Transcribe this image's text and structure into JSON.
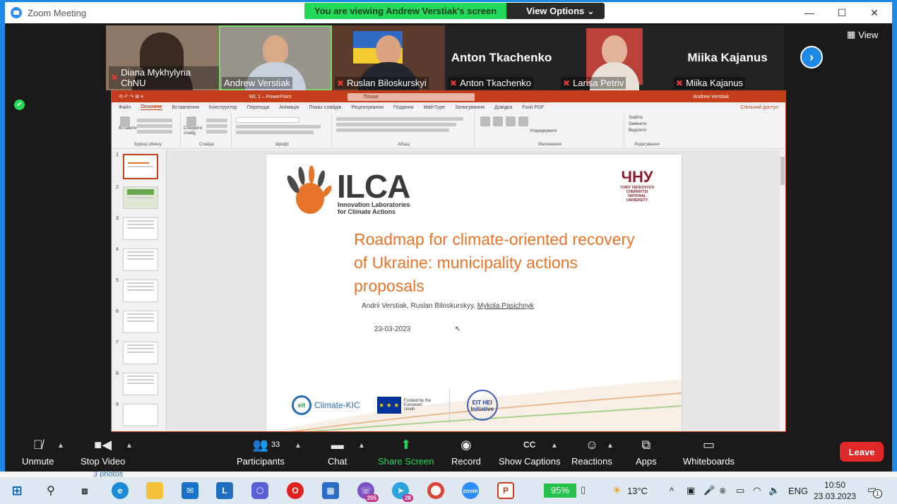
{
  "window": {
    "title": "Zoom Meeting",
    "controls": {
      "minimize": "—",
      "maximize": "☐",
      "close": "✕"
    }
  },
  "share_banner": {
    "viewing": "You are viewing Andrew Verstiak's screen",
    "view_options": "View Options ⌄"
  },
  "gallery": {
    "participants": [
      {
        "name": "Diana Mykhylyna ChNU",
        "video": true,
        "muted": true
      },
      {
        "name": "Andrew Verstiak",
        "video": true,
        "muted": false,
        "active_speaker": true
      },
      {
        "name": "Ruslan Biloskurskyi",
        "video": true,
        "muted": true
      },
      {
        "name": "Anton Tkachenko",
        "video": false,
        "muted": true,
        "big_name": "Anton Tkachenko"
      },
      {
        "name": "Larisa Petriv",
        "video": true,
        "muted": true
      },
      {
        "name": "Miika Kajanus",
        "video": false,
        "muted": true,
        "big_name": "Miika Kajanus"
      }
    ],
    "next_arrow": "›",
    "view_label": "View"
  },
  "ppt": {
    "doc_title": "WL 1 – PowerPoint",
    "search_placeholder": "Пошук",
    "user": "Andrew Verstiak",
    "quick_access": "⟲ ↶ ↷ ⊞ ▾",
    "menu": [
      "Файл",
      "Основне",
      "Вставлення",
      "Конструктор",
      "Переходи",
      "Анімація",
      "Показ слайдів",
      "Рецензування",
      "Подання",
      "MathType",
      "Записування",
      "Довідка",
      "Foxit PDF"
    ],
    "active_menu": "Основне",
    "share_label": "Спільний доступ",
    "ribbon_groups": [
      "Буфер обміну",
      "Слайди",
      "Шрифт",
      "Абзац",
      "Малювання",
      "Редагування"
    ],
    "ribbon_buttons": {
      "paste": "Вставити",
      "new_slide": "Створити слайд",
      "arrange": "Упорядкувати",
      "find": "Знайти",
      "replace": "Замінити",
      "select": "Виділити"
    },
    "slide_numbers": [
      "1",
      "2",
      "3",
      "4",
      "5",
      "6",
      "7",
      "8",
      "9"
    ],
    "slide": {
      "logo_name": "ILCA",
      "logo_sub_1": "Innovation Laboratories",
      "logo_sub_2": "for Climate Actions",
      "univ_mark": "ЧНУ",
      "univ_line_1": "YURIY FEDKOVYCH",
      "univ_line_2": "CHERNIVTSI",
      "univ_line_3": "NATIONAL",
      "univ_line_4": "UNIVERSITY",
      "title": "Roadmap for climate-oriented recovery of Ukraine: municipality actions proposals",
      "authors_plain": "Andrii Verstiak, Ruslan Biloskurskyy, ",
      "authors_underlined": "Mykola Pasichnyk",
      "date": "23-03-2023",
      "partner_1_mark": "eit",
      "partner_1": "Climate-KIC",
      "partner_2_flag": "★ ★ ★",
      "partner_2": "Funded by the European Union",
      "partner_3": "EIT HEI Initiative"
    }
  },
  "toolbar": {
    "unmute": "Unmute",
    "stop_video": "Stop Video",
    "participants": "Participants",
    "participants_count": "33",
    "chat": "Chat",
    "share_screen": "Share Screen",
    "record": "Record",
    "captions": "Show Captions",
    "reactions": "Reactions",
    "apps": "Apps",
    "whiteboards": "Whiteboards",
    "leave": "Leave"
  },
  "behind_window": {
    "text": "3 photos"
  },
  "taskbar": {
    "viber_badge": "205",
    "telegram_badge": "28",
    "battery": "95%",
    "temperature": "13°C",
    "lang": "ENG",
    "time": "10:50",
    "date": "23.03.2023",
    "notifications": "1"
  },
  "colors": {
    "zoom_blue": "#2d8cff",
    "share_green": "#23d959",
    "leave_red": "#e02828",
    "ppt_red": "#c43e1c",
    "slide_title_orange": "#e8742a"
  }
}
